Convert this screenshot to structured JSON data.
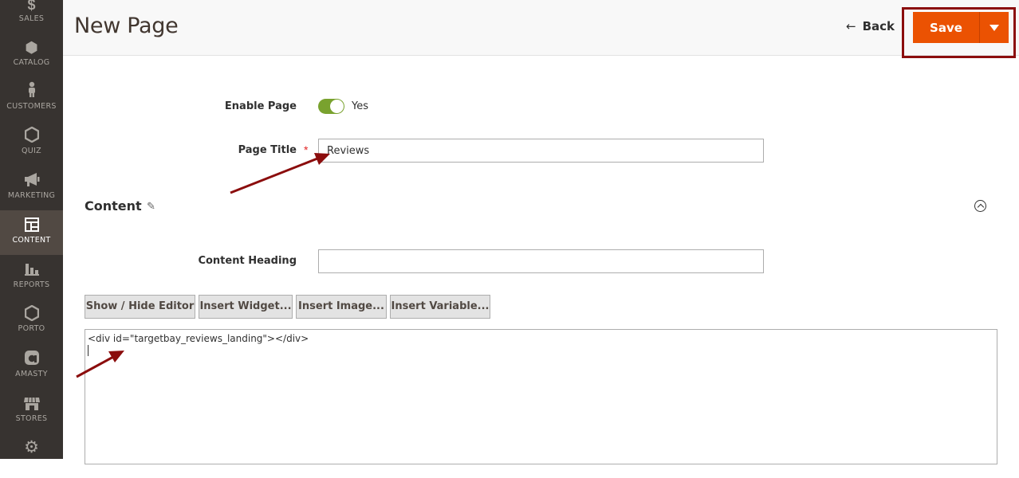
{
  "sidebar": {
    "items": [
      {
        "label": "SALES",
        "icon": "dollar-icon",
        "glyph": "$"
      },
      {
        "label": "CATALOG",
        "icon": "cube-icon",
        "glyph": "⬢"
      },
      {
        "label": "CUSTOMERS",
        "icon": "person-icon",
        "glyph": "👤"
      },
      {
        "label": "QUIZ",
        "icon": "hexagon-icon",
        "glyph": "⬡"
      },
      {
        "label": "MARKETING",
        "icon": "megaphone-icon",
        "glyph": "📢"
      },
      {
        "label": "CONTENT",
        "icon": "layout-icon",
        "glyph": "▣"
      },
      {
        "label": "REPORTS",
        "icon": "bar-chart-icon",
        "glyph": "▮"
      },
      {
        "label": "PORTO",
        "icon": "hexagon-icon",
        "glyph": "⬡"
      },
      {
        "label": "AMASTY",
        "icon": "amasty-logo-icon",
        "glyph": "a"
      },
      {
        "label": "STORES",
        "icon": "store-icon",
        "glyph": "▦"
      },
      {
        "label": "",
        "icon": "gear-icon",
        "glyph": "⚙"
      }
    ],
    "active": "CONTENT"
  },
  "header": {
    "title": "New Page",
    "back_label": "Back",
    "save_label": "Save"
  },
  "form": {
    "enable_page_label": "Enable Page",
    "enable_page_value": "Yes",
    "page_title_label": "Page Title",
    "page_title_required": "*",
    "page_title_value": "Reviews",
    "content_section_title": "Content",
    "content_heading_label": "Content Heading",
    "content_heading_value": "",
    "editor_buttons": [
      "Show / Hide Editor",
      "Insert Widget...",
      "Insert Image...",
      "Insert Variable..."
    ],
    "editor_content": "<div id=\"targetbay_reviews_landing\"></div>"
  },
  "colors": {
    "accent": "#eb5202",
    "toggle_on": "#79a22e",
    "sidebar_bg": "#373330",
    "annotation": "#8b0d0d"
  }
}
